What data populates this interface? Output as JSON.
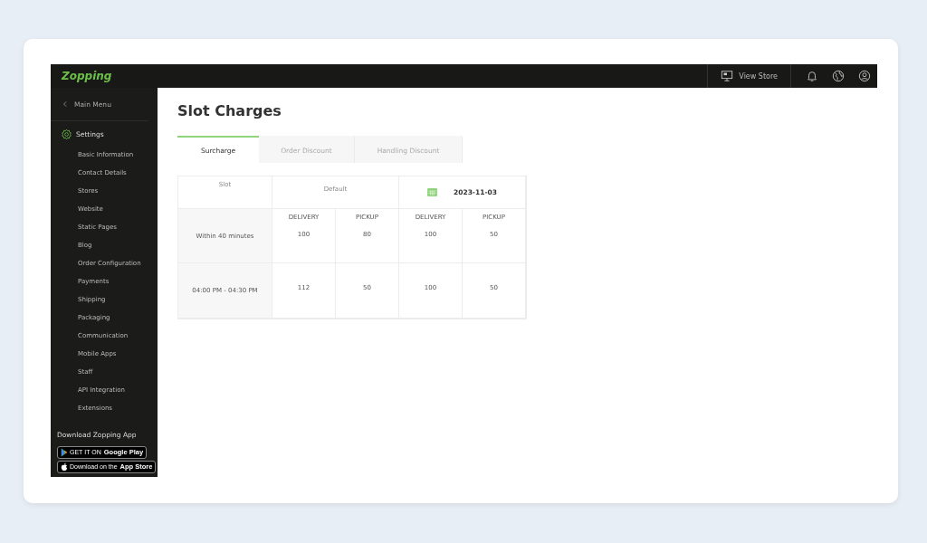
{
  "brand": "Zopping",
  "topbar": {
    "view_store": "View Store"
  },
  "sidebar": {
    "back": "Main Menu",
    "section": "Settings",
    "items": [
      "Basic Information",
      "Contact Details",
      "Stores",
      "Website",
      "Static Pages",
      "Blog",
      "Order Configuration",
      "Payments",
      "Shipping",
      "Packaging",
      "Communication",
      "Mobile Apps",
      "Staff",
      "API Integration",
      "Extensions"
    ],
    "download_label": "Download Zopping App",
    "badges": [
      {
        "kind": "google",
        "small": "GET IT ON",
        "label": "Google Play"
      },
      {
        "kind": "apple",
        "small": "Download on the",
        "label": "App Store"
      }
    ]
  },
  "page_title": "Slot Charges",
  "tabs": [
    {
      "label": "Surcharge",
      "selected": true
    },
    {
      "label": "Order Discount",
      "selected": false
    },
    {
      "label": "Handling Discount",
      "selected": false
    }
  ],
  "table": {
    "slot_heading": "Slot",
    "groups": [
      {
        "kind": "text",
        "label": "Default"
      },
      {
        "kind": "date",
        "label": "2023-11-03"
      }
    ],
    "rows": [
      {
        "slot": "Within 40 minutes",
        "cells": [
          {
            "label": "DELIVERY",
            "value": "100"
          },
          {
            "label": "PICKUP",
            "value": "80"
          },
          {
            "label": "DELIVERY",
            "value": "100"
          },
          {
            "label": "PICKUP",
            "value": "50"
          }
        ]
      },
      {
        "slot": "04:00 PM - 04:30 PM",
        "cells": [
          {
            "value": "112"
          },
          {
            "value": "50"
          },
          {
            "value": "100"
          },
          {
            "value": "50"
          }
        ]
      }
    ]
  }
}
